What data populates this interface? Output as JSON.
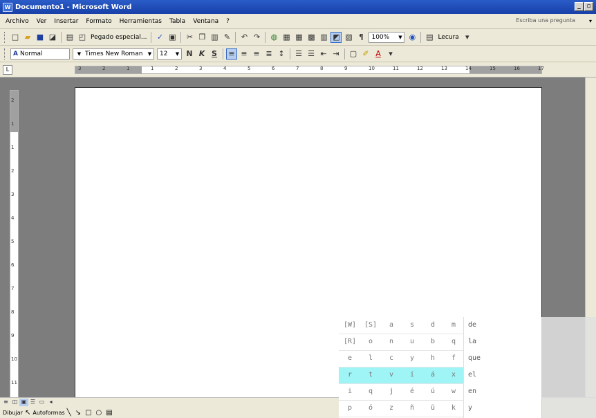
{
  "window": {
    "title": "Documento1 - Microsoft Word",
    "app_icon": "W",
    "controls": [
      "_",
      "▫"
    ]
  },
  "menu": {
    "items": [
      "Archivo",
      "Ver",
      "Insertar",
      "Formato",
      "Herramientas",
      "Tabla",
      "Ventana",
      "?"
    ],
    "help_placeholder": "Escriba una pregunta"
  },
  "toolbar1": {
    "paste_special_label": "Pegado especial...",
    "zoom": "100%",
    "read_label": "Lecura"
  },
  "toolbar2": {
    "style": "Normal",
    "font": "Times New Roman",
    "size": "12",
    "bold": "N",
    "italic": "K",
    "underline": "S"
  },
  "ruler": {
    "corner": "L",
    "h_numbers": [
      "3",
      "2",
      "1",
      "1",
      "2",
      "3",
      "4",
      "5",
      "6",
      "7",
      "8",
      "9",
      "10",
      "11",
      "12",
      "13",
      "14",
      "15",
      "16",
      "17"
    ],
    "v_numbers": [
      "2",
      "1",
      "1",
      "2",
      "3",
      "4",
      "5",
      "6",
      "7",
      "8",
      "9",
      "10",
      "11"
    ]
  },
  "drawbar": {
    "draw_label": "Dibujar",
    "autoshapes_label": "Autoformas"
  },
  "ime_panel": {
    "rows": [
      [
        "[W]",
        "[S]",
        "a",
        "s",
        "d",
        "m"
      ],
      [
        "[R]",
        "o",
        "n",
        "u",
        "b",
        "q"
      ],
      [
        "e",
        "l",
        "c",
        "y",
        "h",
        "f"
      ],
      [
        "r",
        "t",
        "v",
        "í",
        "á",
        "x"
      ],
      [
        "i",
        "q",
        "j",
        "é",
        "ú",
        "w"
      ],
      [
        "p",
        "ó",
        "z",
        "ñ",
        "ü",
        "k"
      ]
    ],
    "highlighted_row": 3,
    "words": [
      "de",
      "la",
      "que",
      "el",
      "en",
      "y"
    ],
    "colors": {
      "highlight": "#9ff4f6"
    }
  }
}
